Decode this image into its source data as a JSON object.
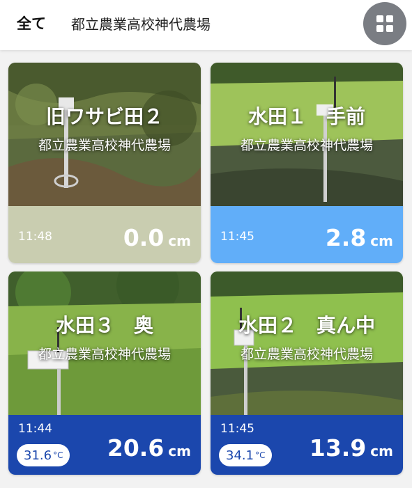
{
  "header": {
    "filter_label": "全て",
    "farm_name": "都立農業高校神代農場",
    "menu_icon": "grid-icon"
  },
  "cards": [
    {
      "title": "旧ワサビ田２",
      "subtitle": "都立農業高校神代農場",
      "time": "11:48",
      "level": "0.0",
      "unit": "cm",
      "footer_color": "#c9cdb0",
      "text_color": "#ffffff"
    },
    {
      "title": "水田１　手前",
      "subtitle": "都立農業高校神代農場",
      "time": "11:45",
      "level": "2.8",
      "unit": "cm",
      "footer_color": "#61aef9",
      "text_color": "#ffffff"
    },
    {
      "title": "水田３　奥",
      "subtitle": "都立農業高校神代農場",
      "time": "11:44",
      "temperature": "31.6",
      "temperature_unit": "°C",
      "level": "20.6",
      "unit": "cm",
      "footer_color": "#1b47ad",
      "text_color": "#ffffff"
    },
    {
      "title": "水田２　真ん中",
      "subtitle": "都立農業高校神代農場",
      "time": "11:45",
      "temperature": "34.1",
      "temperature_unit": "°C",
      "level": "13.9",
      "unit": "cm",
      "footer_color": "#1b47ad",
      "text_color": "#ffffff"
    }
  ]
}
